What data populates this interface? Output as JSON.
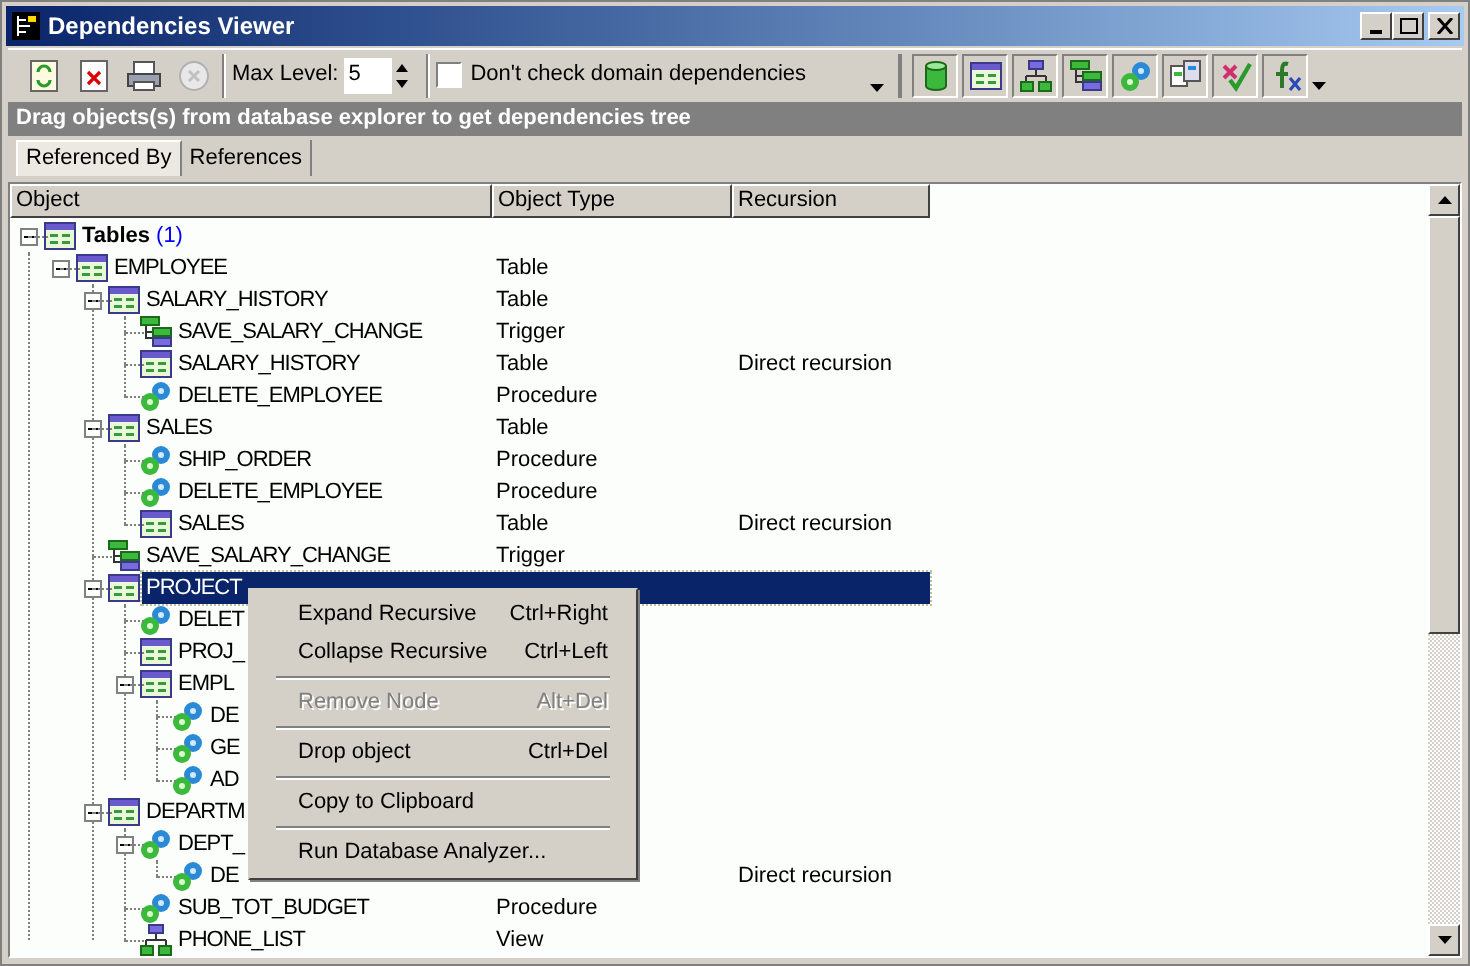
{
  "window": {
    "title": "Dependencies Viewer"
  },
  "toolbar": {
    "max_level_label": "Max Level:",
    "max_level": "5",
    "domain_checkbox": {
      "label": "Don't check domain dependencies",
      "checked": false
    }
  },
  "banner": "Drag objects(s) from database explorer to get dependencies tree",
  "tabs": [
    {
      "label": "Referenced By",
      "selected": true
    },
    {
      "label": "References",
      "selected": false
    }
  ],
  "table": {
    "columns": [
      "Object",
      "Object Type",
      "Recursion"
    ],
    "root": {
      "name": "Tables",
      "count": "(1)",
      "expanded": true,
      "children": [
        {
          "name": "EMPLOYEE",
          "type": "Table",
          "kind": "table",
          "expanded": true,
          "selected": false,
          "children": [
            {
              "name": "SALARY_HISTORY",
              "type": "Table",
              "kind": "table",
              "expanded": true,
              "selected": false,
              "children": [
                {
                  "name": "SAVE_SALARY_CHANGE",
                  "type": "Trigger",
                  "kind": "trigger",
                  "selected": false
                },
                {
                  "name": "SALARY_HISTORY",
                  "type": "Table",
                  "recursion": "Direct recursion",
                  "kind": "table",
                  "selected": false
                },
                {
                  "name": "DELETE_EMPLOYEE",
                  "type": "Procedure",
                  "kind": "procedure",
                  "selected": false
                }
              ]
            },
            {
              "name": "SALES",
              "type": "Table",
              "kind": "table",
              "expanded": true,
              "selected": false,
              "children": [
                {
                  "name": "SHIP_ORDER",
                  "type": "Procedure",
                  "kind": "procedure",
                  "selected": false
                },
                {
                  "name": "DELETE_EMPLOYEE",
                  "type": "Procedure",
                  "kind": "procedure",
                  "selected": false
                },
                {
                  "name": "SALES",
                  "type": "Table",
                  "recursion": "Direct recursion",
                  "kind": "table",
                  "selected": false
                }
              ]
            },
            {
              "name": "SAVE_SALARY_CHANGE",
              "type": "Trigger",
              "kind": "trigger",
              "selected": false
            },
            {
              "name": "PROJECT",
              "kind": "table",
              "expanded": true,
              "selected": true,
              "children": [
                {
                  "name": "DELET",
                  "kind": "procedure",
                  "selected": false
                },
                {
                  "name": "PROJ_",
                  "kind": "table",
                  "selected": false
                },
                {
                  "name": "EMPL",
                  "kind": "table",
                  "expanded": true,
                  "selected": false,
                  "children": [
                    {
                      "name": "DE",
                      "kind": "procedure",
                      "selected": false
                    },
                    {
                      "name": "GE",
                      "kind": "procedure",
                      "selected": false
                    },
                    {
                      "name": "AD",
                      "kind": "procedure",
                      "selected": false
                    }
                  ]
                }
              ]
            },
            {
              "name": "DEPARTM",
              "kind": "table",
              "expanded": true,
              "selected": false,
              "children": [
                {
                  "name": "DEPT_",
                  "kind": "procedure",
                  "expanded": true,
                  "selected": false,
                  "children": [
                    {
                      "name": "DE",
                      "recursion": "Direct recursion",
                      "kind": "procedure",
                      "selected": false
                    }
                  ]
                },
                {
                  "name": "SUB_TOT_BUDGET",
                  "type": "Procedure",
                  "kind": "procedure",
                  "selected": false
                },
                {
                  "name": "PHONE_LIST",
                  "type": "View",
                  "kind": "view",
                  "selected": false
                }
              ]
            }
          ]
        }
      ]
    }
  },
  "context_menu": {
    "items": [
      {
        "kind": "item",
        "label": "Expand Recursive",
        "shortcut": "Ctrl+Right",
        "disabled": false
      },
      {
        "kind": "item",
        "label": "Collapse Recursive",
        "shortcut": "Ctrl+Left",
        "disabled": false
      },
      {
        "kind": "separator"
      },
      {
        "kind": "item",
        "label": "Remove Node",
        "shortcut": "Alt+Del",
        "disabled": true
      },
      {
        "kind": "separator"
      },
      {
        "kind": "item",
        "label": "Drop object",
        "shortcut": "Ctrl+Del",
        "disabled": false
      },
      {
        "kind": "separator"
      },
      {
        "kind": "item",
        "label": "Copy to Clipboard",
        "disabled": false
      },
      {
        "kind": "separator"
      },
      {
        "kind": "item",
        "label": "Run Database Analyzer...",
        "disabled": false
      }
    ]
  }
}
